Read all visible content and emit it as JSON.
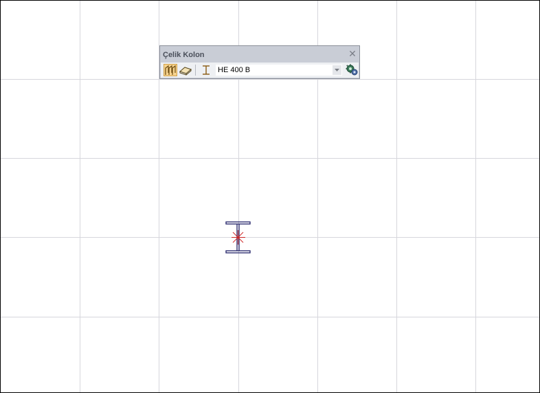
{
  "toolbar": {
    "title": "Çelik Kolon",
    "close_glyph": "✕",
    "tools": [
      {
        "icon": "column-wall-tool-icon",
        "active": true
      },
      {
        "icon": "slab-tool-icon",
        "active": false
      },
      {
        "icon": "i-beam-section-icon",
        "active": false
      }
    ],
    "section_select": {
      "value": "HE 400 B",
      "arrow_icon": "chevron-down-icon"
    },
    "settings_icon": "gears-settings-icon"
  },
  "canvas": {
    "background": "#ffffff",
    "grid_color": "#d6d6dc",
    "column_symbol": {
      "section_color": "#1f1f66",
      "marker_color": "#cc2222"
    }
  },
  "colors": {
    "toolbar_header": "#c9cdd6",
    "toolbar_body": "#eef0f3",
    "active_tool": "#f6d38e"
  }
}
